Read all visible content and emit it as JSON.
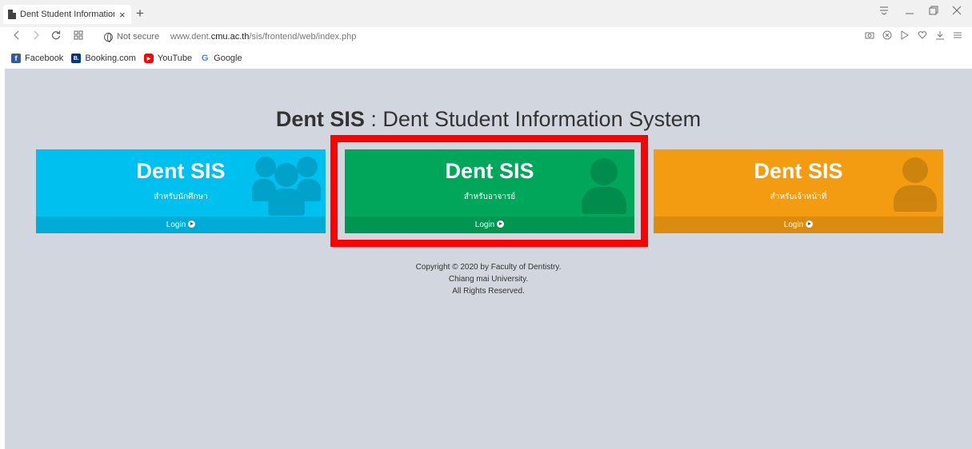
{
  "browser": {
    "tab_title": "Dent Student Information S",
    "close_glyph": "×",
    "new_tab_glyph": "+",
    "security_label": "Not secure",
    "url_prefix": "www.dent.",
    "url_domain": "cmu.ac.th",
    "url_path": "/sis/frontend/web/index.php",
    "bookmarks": [
      {
        "label": "Facebook",
        "icon": "facebook-icon",
        "color": "#3b5998",
        "glyph": "f"
      },
      {
        "label": "Booking.com",
        "icon": "booking-icon",
        "color": "#003580",
        "glyph": "B."
      },
      {
        "label": "YouTube",
        "icon": "youtube-icon",
        "color": "#ff0000",
        "glyph": "▶"
      },
      {
        "label": "Google",
        "icon": "google-icon",
        "color": "#4285f4",
        "glyph": "G"
      }
    ]
  },
  "header": {
    "brand": "Dent SIS",
    "subtitle": " : Dent Student Information System"
  },
  "cards": [
    {
      "title": "Dent SIS",
      "subtitle": "สำหรับนักศึกษา",
      "login": "Login",
      "color": "#00c0ef",
      "icon": "users-icon"
    },
    {
      "title": "Dent SIS",
      "subtitle": "สำหรับอาจารย์",
      "login": "Login",
      "color": "#00a65a",
      "icon": "doctor-icon"
    },
    {
      "title": "Dent SIS",
      "subtitle": "สำหรับเจ้าหน้าที่",
      "login": "Login",
      "color": "#f39c12",
      "icon": "user-icon"
    }
  ],
  "highlight_color": "#ff0000",
  "footer": {
    "line1": "Copyright © 2020 by Faculty of Dentistry.",
    "line2": "Chiang mai University.",
    "line3": "All Rights Reserved."
  }
}
